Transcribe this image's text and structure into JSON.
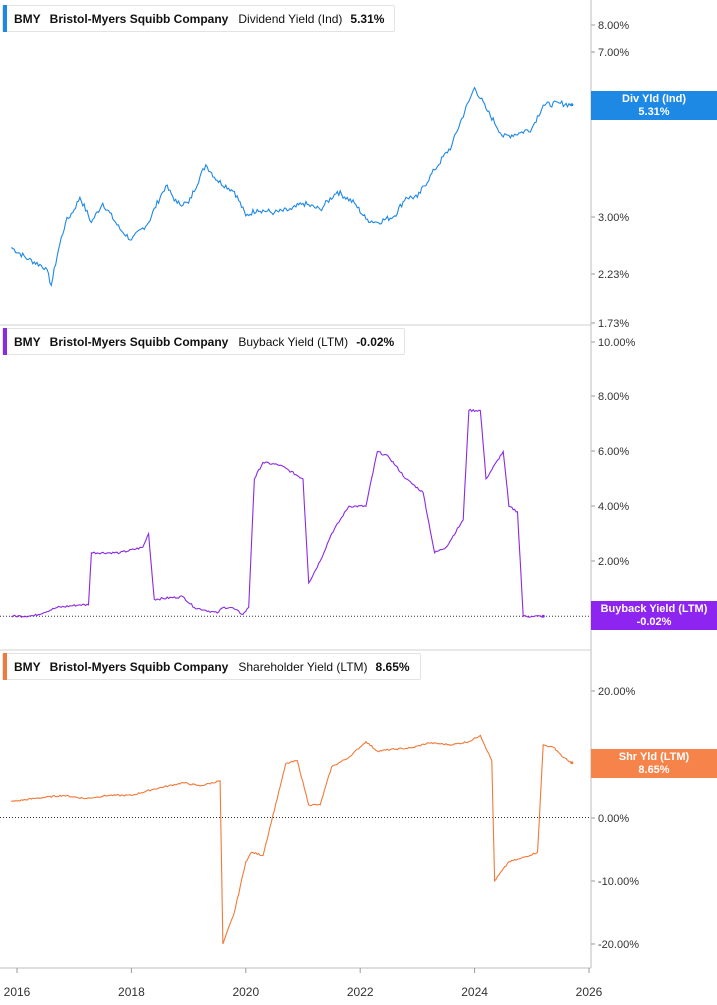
{
  "panels": [
    {
      "id": "div",
      "ticker": "BMY",
      "company": "Bristol-Myers Squibb Company",
      "metric": "Dividend Yield (Ind)",
      "value": "5.31%",
      "tag_line1": "Div Yld (Ind)",
      "tag_line2": "5.31%",
      "color": "#1e88e5",
      "tag_bg": "#1e88e5",
      "y_ticks": [
        "8.00%",
        "7.00%",
        "3.00%",
        "2.23%",
        "1.73%"
      ]
    },
    {
      "id": "buyback",
      "ticker": "BMY",
      "company": "Bristol-Myers Squibb Company",
      "metric": "Buyback Yield (LTM)",
      "value": "-0.02%",
      "tag_line1": "Buyback Yield (LTM)",
      "tag_line2": "-0.02%",
      "color": "#8a2be2",
      "tag_bg": "#8e24f0",
      "y_ticks": [
        "10.00%",
        "8.00%",
        "6.00%",
        "4.00%",
        "2.00%"
      ]
    },
    {
      "id": "shr",
      "ticker": "BMY",
      "company": "Bristol-Myers Squibb Company",
      "metric": "Shareholder Yield (LTM)",
      "value": "8.65%",
      "tag_line1": "Shr Yld (LTM)",
      "tag_line2": "8.65%",
      "color": "#f07a3a",
      "tag_bg": "#f5834a",
      "y_ticks": [
        "20.00%",
        "10.00%",
        "0.00%",
        "-10.00%",
        "-20.00%"
      ]
    }
  ],
  "x_ticks": [
    "2016",
    "2018",
    "2020",
    "2022",
    "2024",
    "2026"
  ],
  "chart_data": [
    {
      "type": "line",
      "title": "BMY Bristol-Myers Squibb Company Dividend Yield (Ind) 5.31%",
      "y_scale": "log",
      "ylim": [
        1.73,
        9.0
      ],
      "x": [
        2015.9,
        2016.2,
        2016.5,
        2016.6,
        2016.75,
        2016.85,
        2017.0,
        2017.1,
        2017.3,
        2017.5,
        2017.8,
        2018.0,
        2018.3,
        2018.6,
        2018.8,
        2019.0,
        2019.3,
        2019.5,
        2019.8,
        2020.0,
        2020.2,
        2020.5,
        2020.8,
        2021.0,
        2021.3,
        2021.6,
        2021.9,
        2022.1,
        2022.3,
        2022.6,
        2022.8,
        2023.0,
        2023.3,
        2023.6,
        2023.9,
        2024.0,
        2024.2,
        2024.5,
        2024.8,
        2025.0,
        2025.2,
        2025.5,
        2025.7
      ],
      "values": [
        2.55,
        2.4,
        2.3,
        2.1,
        2.6,
        2.9,
        3.1,
        3.3,
        2.9,
        3.2,
        2.8,
        2.65,
        2.9,
        3.5,
        3.2,
        3.2,
        3.9,
        3.6,
        3.4,
        3.0,
        3.1,
        3.05,
        3.1,
        3.2,
        3.1,
        3.4,
        3.2,
        2.95,
        2.9,
        3.0,
        3.3,
        3.3,
        3.8,
        4.3,
        5.4,
        5.8,
        5.2,
        4.5,
        4.6,
        4.7,
        5.3,
        5.35,
        5.31
      ],
      "last_value": 5.31
    },
    {
      "type": "line",
      "title": "BMY Bristol-Myers Squibb Company Buyback Yield (LTM) -0.02%",
      "ylim": [
        -0.4,
        10.0
      ],
      "x": [
        2015.9,
        2016.3,
        2016.7,
        2017.1,
        2017.25,
        2017.3,
        2017.8,
        2018.2,
        2018.3,
        2018.4,
        2018.9,
        2019.1,
        2019.3,
        2019.5,
        2019.6,
        2019.75,
        2019.95,
        2020.05,
        2020.15,
        2020.3,
        2020.6,
        2021.0,
        2021.1,
        2021.3,
        2021.5,
        2021.8,
        2022.1,
        2022.3,
        2022.5,
        2022.8,
        2023.1,
        2023.3,
        2023.5,
        2023.8,
        2023.9,
        2024.1,
        2024.2,
        2024.5,
        2024.6,
        2024.75,
        2024.85,
        2025.0,
        2025.2
      ],
      "values": [
        -0.02,
        0.0,
        0.3,
        0.4,
        0.4,
        2.3,
        2.3,
        2.5,
        3.0,
        0.6,
        0.7,
        0.3,
        0.2,
        0.1,
        0.3,
        0.3,
        0.05,
        0.3,
        5.0,
        5.6,
        5.5,
        5.0,
        1.2,
        2.0,
        3.0,
        4.0,
        4.0,
        6.0,
        5.8,
        5.0,
        4.5,
        2.3,
        2.5,
        3.5,
        7.5,
        7.5,
        5.0,
        6.0,
        4.0,
        3.8,
        -0.02,
        -0.02,
        -0.02
      ],
      "last_value": -0.02
    },
    {
      "type": "line",
      "title": "BMY Bristol-Myers Squibb Company Shareholder Yield (LTM) 8.65%",
      "ylim": [
        -21.0,
        21.0
      ],
      "x": [
        2015.9,
        2016.3,
        2016.8,
        2017.2,
        2017.6,
        2018.0,
        2018.4,
        2018.9,
        2019.2,
        2019.55,
        2019.6,
        2019.8,
        2020.0,
        2020.1,
        2020.3,
        2020.7,
        2020.9,
        2021.1,
        2021.3,
        2021.5,
        2021.8,
        2022.1,
        2022.3,
        2022.6,
        2022.9,
        2023.2,
        2023.6,
        2023.9,
        2024.1,
        2024.3,
        2024.35,
        2024.6,
        2024.8,
        2025.1,
        2025.2,
        2025.4,
        2025.55,
        2025.7
      ],
      "values": [
        2.5,
        3.0,
        3.5,
        3.0,
        3.5,
        3.5,
        4.5,
        5.5,
        5.0,
        5.8,
        -20.0,
        -15.0,
        -7.0,
        -5.5,
        -6.0,
        8.5,
        9.0,
        2.0,
        2.0,
        8.0,
        9.5,
        12.0,
        10.5,
        10.8,
        11.0,
        11.8,
        11.5,
        12.0,
        13.0,
        9.0,
        -10.0,
        -7.0,
        -6.5,
        -5.5,
        11.5,
        11.0,
        9.5,
        8.65
      ],
      "last_value": 8.65
    }
  ]
}
